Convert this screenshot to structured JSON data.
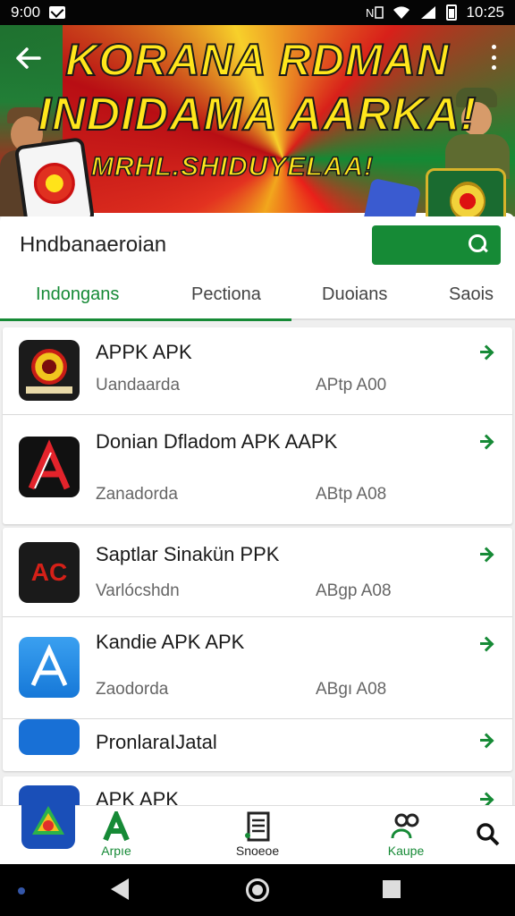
{
  "status_bar": {
    "time_left": "9:00",
    "time_right": "10:25",
    "icons": [
      "mail-icon",
      "nfc-icon",
      "wifi-icon",
      "signal-icon",
      "battery-icon"
    ]
  },
  "banner": {
    "line1": "KORANA RDMAN",
    "line2": "INDIDAMA AARKA!",
    "line3": "MRHL.SHIDUYELAA!"
  },
  "search": {
    "label": "Hndbanaeroian"
  },
  "tabs": [
    {
      "label": "Indongans",
      "active": true
    },
    {
      "label": "Pectiona",
      "active": false
    },
    {
      "label": "Duoians",
      "active": false
    },
    {
      "label": "Saois",
      "active": false
    }
  ],
  "items": [
    {
      "title": "APPK APK",
      "sub": "Uandaarda",
      "meta": "APtp A00"
    },
    {
      "title": "Donian Dfladom APK AAPK",
      "sub": "Zanadorda",
      "meta": "ABtp A08"
    },
    {
      "title": "Saptlar Sinakün PPK",
      "sub": "Varlócshdn",
      "meta": "ABgp A08",
      "icon_text": "AC"
    },
    {
      "title": "Kandie APK APK",
      "sub": "Zaodorda",
      "meta": "ABgı A08"
    },
    {
      "title": "PronlaraIJatal",
      "sub": "",
      "meta": ""
    },
    {
      "title": "APK  APK",
      "sub": "",
      "meta": ""
    }
  ],
  "bottom_nav": [
    {
      "label": "Arpıe",
      "active": true
    },
    {
      "label": "Snoeoe",
      "active": false
    },
    {
      "label": "Kaupe",
      "active": true
    }
  ],
  "colors": {
    "accent": "#168a36",
    "banner_yellow": "#ffe61c",
    "banner_red": "#d8201a"
  }
}
